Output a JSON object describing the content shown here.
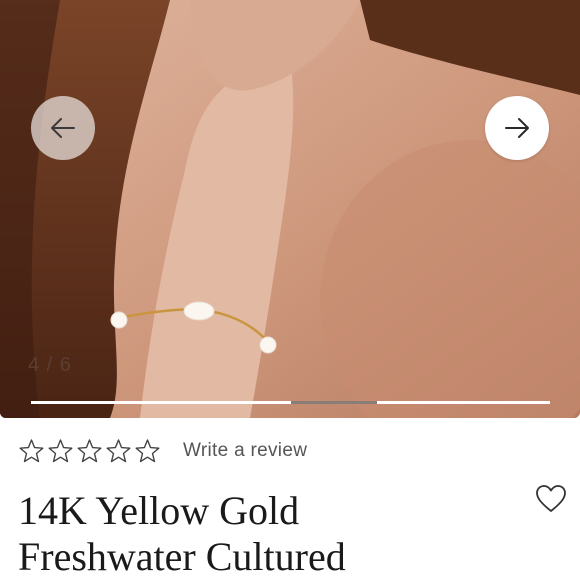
{
  "gallery": {
    "counter": "4 / 6",
    "current_index": 4,
    "total_images": 6,
    "prev_icon": "arrow-left-icon",
    "next_icon": "arrow-right-icon",
    "progress_start": 0.5,
    "progress_end": 0.667
  },
  "rating": {
    "star_count": 5,
    "filled_stars": 0,
    "review_link_label": "Write a review"
  },
  "product": {
    "title_line1": "14K Yellow Gold",
    "title_line2": "Freshwater Cultured"
  },
  "favorite": {
    "icon": "heart-outline-icon"
  },
  "colors": {
    "title": "#1a1a1a",
    "review_text": "#555555",
    "progress_active": "#8a7c76",
    "progress_track": "#ffffff"
  }
}
